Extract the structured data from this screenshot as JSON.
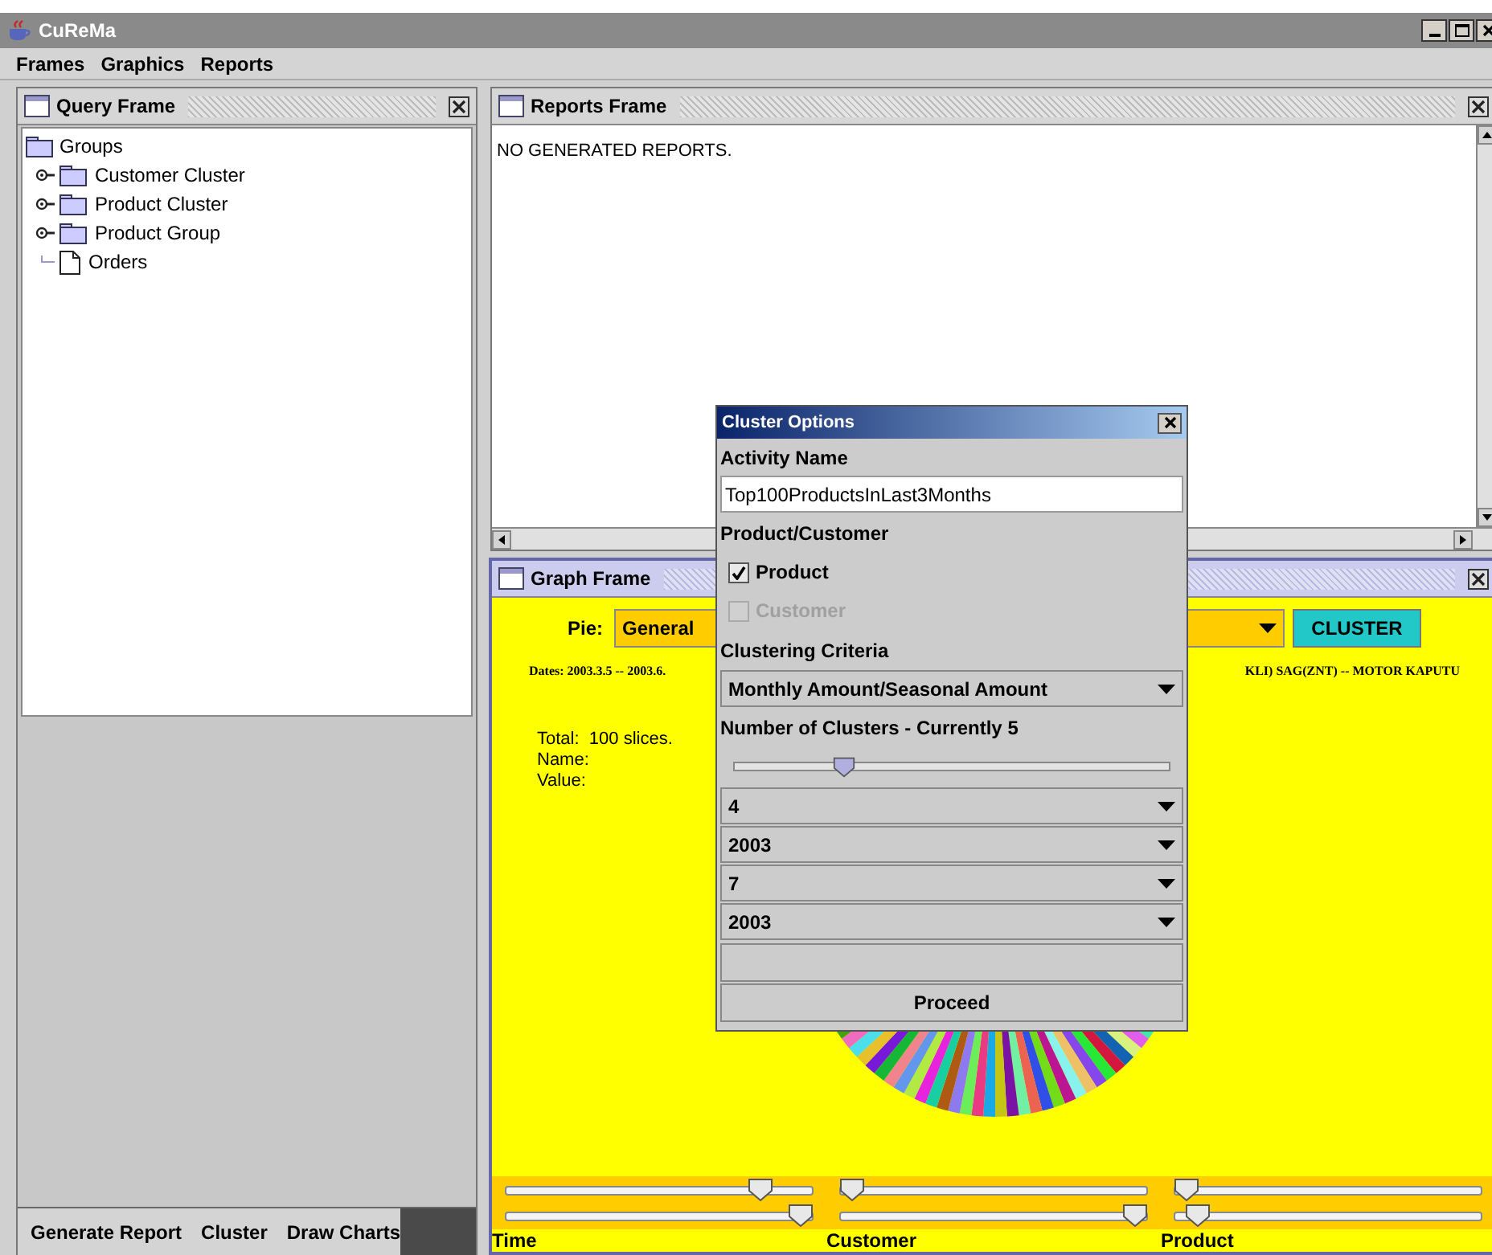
{
  "app": {
    "title": "CuReMa"
  },
  "menu": [
    "Frames",
    "Graphics",
    "Reports"
  ],
  "query_frame": {
    "title": "Query Frame",
    "tree": {
      "label": "Groups",
      "children": [
        {
          "label": "Customer Cluster",
          "kind": "folder"
        },
        {
          "label": "Product Cluster",
          "kind": "folder"
        },
        {
          "label": "Product Group",
          "kind": "folder"
        },
        {
          "label": "Orders",
          "kind": "document"
        }
      ]
    },
    "buttons": [
      "Generate Report",
      "Cluster",
      "Draw Charts"
    ]
  },
  "reports_frame": {
    "title": "Reports Frame",
    "text": "NO GENERATED REPORTS."
  },
  "graph_frame": {
    "title": "Graph Frame",
    "chart_label": "Pie:",
    "chart_type": "General",
    "cluster_button": "CLUSTER",
    "dates_left": "Dates: 2003.3.5 -- 2003.6.",
    "dates_right": "KLI) SAG(ZNT) -- MOTOR KAPUTU",
    "info": [
      "Total:  100 slices.",
      "Name:",
      "Value:"
    ],
    "ranges": [
      {
        "label": "Time",
        "sliders": [
          {
            "level": 0.86
          },
          {
            "level": 1
          }
        ]
      },
      {
        "label": "Customer",
        "sliders": [
          {
            "level": 0
          },
          {
            "level": 1
          }
        ]
      },
      {
        "label": "Product",
        "sliders": [
          {
            "level": 0
          },
          {
            "level": 0.04
          }
        ]
      }
    ]
  },
  "dialog": {
    "title": "Cluster Options",
    "activity_label": "Activity Name",
    "activity_value": "Top100ProductsInLast3Months",
    "type_label": "Product/Customer",
    "options": [
      {
        "label": "Product",
        "checked": true,
        "disabled": false
      },
      {
        "label": "Customer",
        "checked": false,
        "disabled": true
      }
    ],
    "criteria_label": "Clustering Criteria",
    "criteria": "Monthly Amount/Seasonal Amount",
    "clusters_label": "Number of Clusters - Currently 5",
    "clusters_slider": {
      "level": 0.24
    },
    "date_selects": [
      "4",
      "2003",
      "7",
      "2003"
    ],
    "proceed": "Proceed"
  }
}
